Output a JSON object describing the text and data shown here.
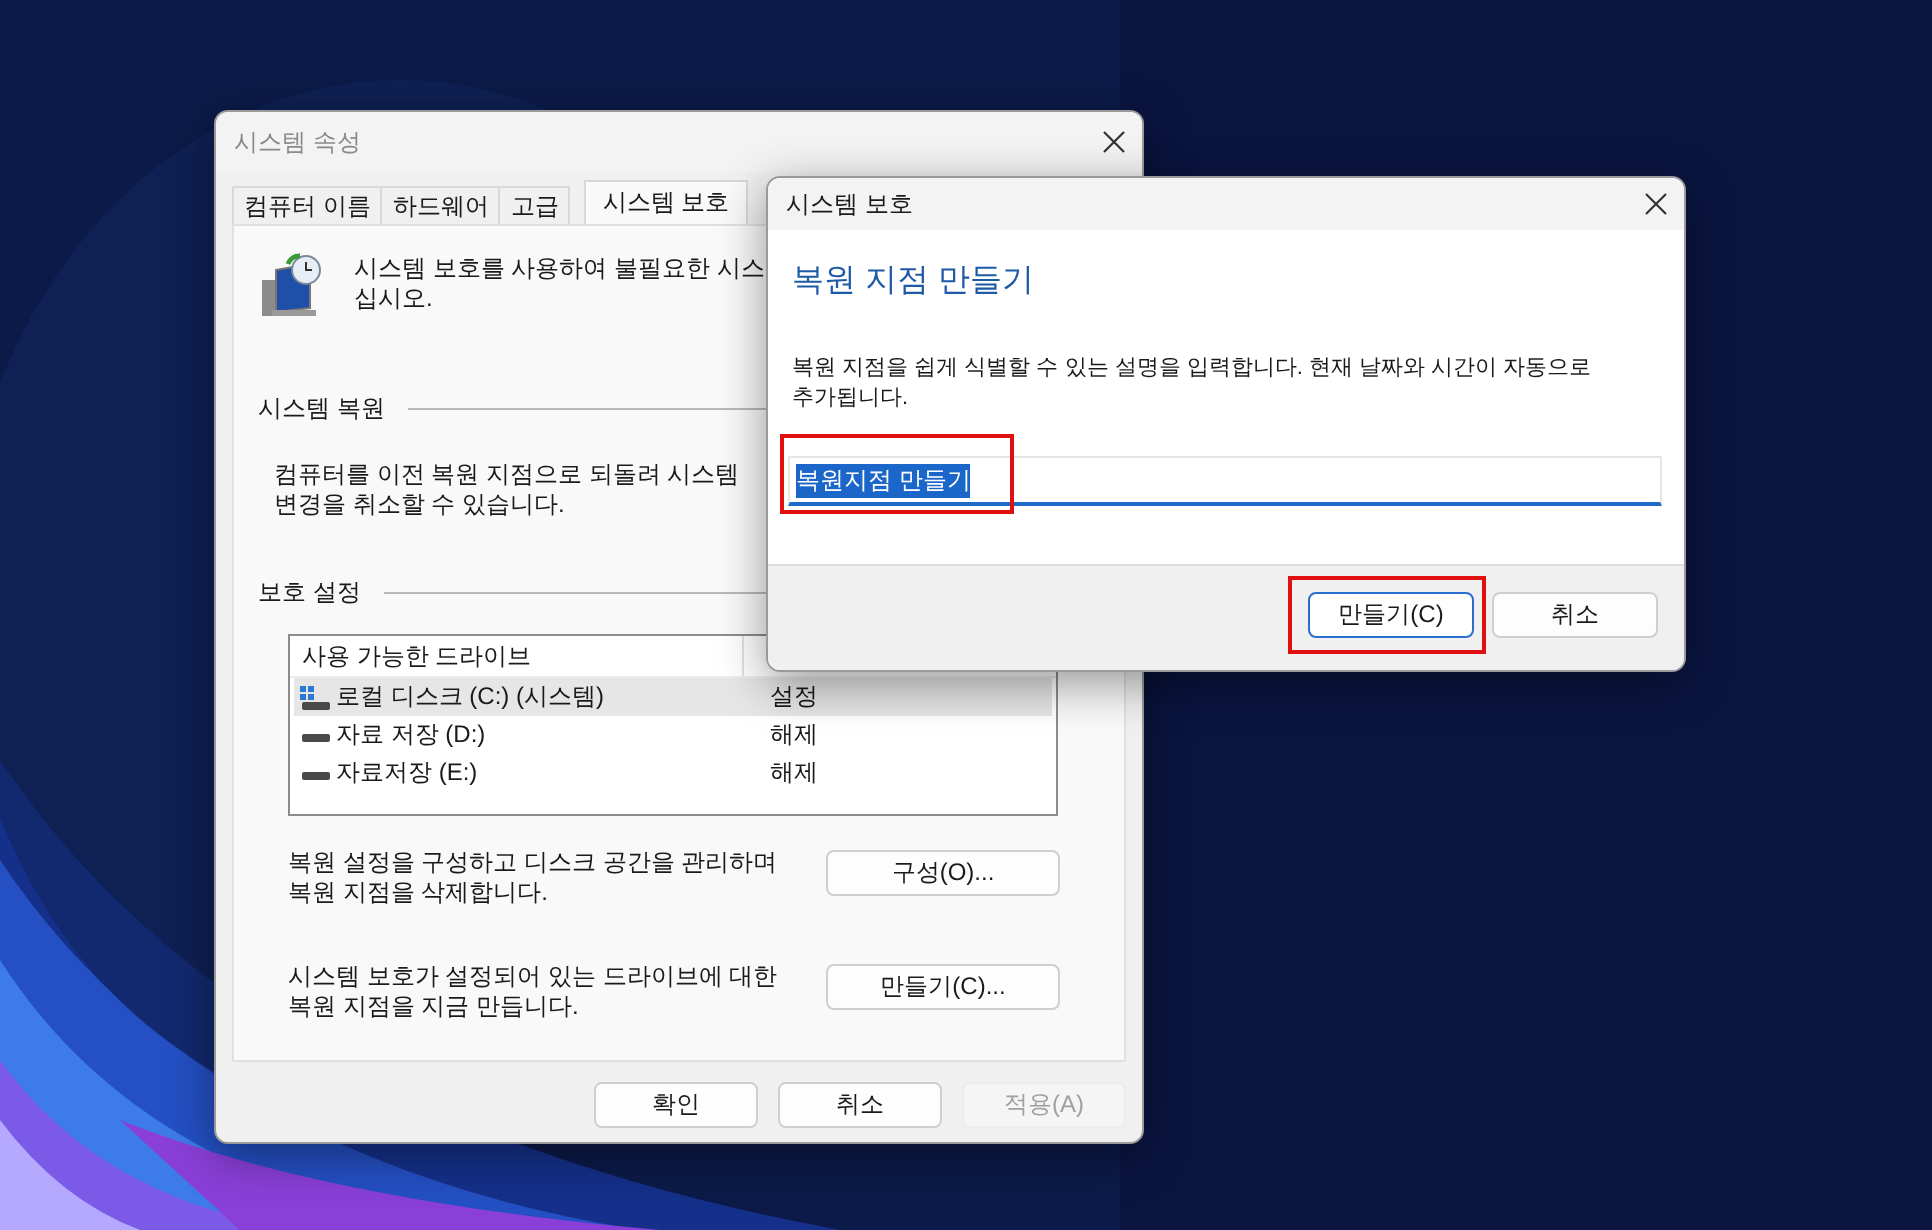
{
  "properties_window": {
    "title": "시스템 속성",
    "tabs": [
      {
        "label": "컴퓨터 이름",
        "selected": false
      },
      {
        "label": "하드웨어",
        "selected": false
      },
      {
        "label": "고급",
        "selected": false
      },
      {
        "label": "시스템 보호",
        "selected": true
      }
    ],
    "intro": "시스템 보호를 사용하여 불필요한 시스\n십시오.",
    "restore_section": {
      "heading": "시스템 복원",
      "text": "컴퓨터를 이전 복원 지점으로 되돌려 시스템 변경을 취소할 수 있습니다."
    },
    "protection_section": {
      "heading": "보호 설정",
      "columns": [
        "사용 가능한 드라이브"
      ],
      "rows": [
        {
          "drive": "로컬 디스크 (C:) (시스템)",
          "kind": "system",
          "protection": "설정",
          "selected": true
        },
        {
          "drive": "자료 저장 (D:)",
          "kind": "data",
          "protection": "해제",
          "selected": false
        },
        {
          "drive": "자료저장 (E:)",
          "kind": "data",
          "protection": "해제",
          "selected": false
        }
      ],
      "actions": [
        {
          "text": "복원 설정을 구성하고 디스크 공간을 관리하며 복원 지점을 삭제합니다.",
          "button": "구성(O)..."
        },
        {
          "text": "시스템 보호가 설정되어 있는 드라이브에 대한 복원 지점을 지금 만듭니다.",
          "button": "만들기(C)..."
        }
      ]
    },
    "buttons": [
      {
        "label": "확인",
        "disabled": false
      },
      {
        "label": "취소",
        "disabled": false
      },
      {
        "label": "적용(A)",
        "disabled": true
      }
    ]
  },
  "dialog": {
    "title": "시스템 보호",
    "heading": "복원 지점 만들기",
    "description": "복원 지점을 쉽게 식별할 수 있는 설명을 입력합니다. 현재 날짜와 시간이 자동으로 추가됩니다.",
    "field": {
      "value": "복원지점 만들기",
      "text_selected": true,
      "highlighted": true
    },
    "buttons": [
      {
        "label": "만들기(C)",
        "default": true,
        "highlighted": true
      },
      {
        "label": "취소",
        "default": false,
        "highlighted": false
      }
    ]
  }
}
